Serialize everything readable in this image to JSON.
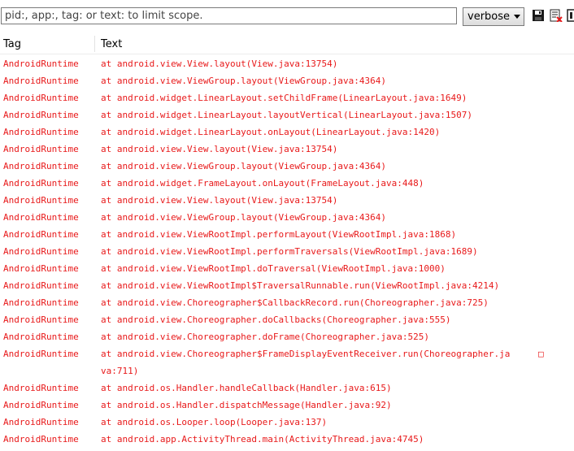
{
  "toolbar": {
    "search_placeholder": "pid:, app:, tag: or text: to limit scope.",
    "level_value": "verbose",
    "icons": [
      "save-icon",
      "clear-log-icon",
      "scroll-lock-icon"
    ]
  },
  "columns": {
    "tag": "Tag",
    "text": "Text"
  },
  "colors": {
    "error_text": "#e8191a"
  },
  "log": [
    {
      "tag": "AndroidRuntime",
      "text": "at android.view.View.layout(View.java:13754)"
    },
    {
      "tag": "AndroidRuntime",
      "text": "at android.view.ViewGroup.layout(ViewGroup.java:4364)"
    },
    {
      "tag": "AndroidRuntime",
      "text": "at android.widget.LinearLayout.setChildFrame(LinearLayout.java:1649)"
    },
    {
      "tag": "AndroidRuntime",
      "text": "at android.widget.LinearLayout.layoutVertical(LinearLayout.java:1507)"
    },
    {
      "tag": "AndroidRuntime",
      "text": "at android.widget.LinearLayout.onLayout(LinearLayout.java:1420)"
    },
    {
      "tag": "AndroidRuntime",
      "text": "at android.view.View.layout(View.java:13754)"
    },
    {
      "tag": "AndroidRuntime",
      "text": "at android.view.ViewGroup.layout(ViewGroup.java:4364)"
    },
    {
      "tag": "AndroidRuntime",
      "text": "at android.widget.FrameLayout.onLayout(FrameLayout.java:448)"
    },
    {
      "tag": "AndroidRuntime",
      "text": "at android.view.View.layout(View.java:13754)"
    },
    {
      "tag": "AndroidRuntime",
      "text": "at android.view.ViewGroup.layout(ViewGroup.java:4364)"
    },
    {
      "tag": "AndroidRuntime",
      "text": "at android.view.ViewRootImpl.performLayout(ViewRootImpl.java:1868)"
    },
    {
      "tag": "AndroidRuntime",
      "text": "at android.view.ViewRootImpl.performTraversals(ViewRootImpl.java:1689)"
    },
    {
      "tag": "AndroidRuntime",
      "text": "at android.view.ViewRootImpl.doTraversal(ViewRootImpl.java:1000)"
    },
    {
      "tag": "AndroidRuntime",
      "text": "at android.view.ViewRootImpl$TraversalRunnable.run(ViewRootImpl.java:4214)"
    },
    {
      "tag": "AndroidRuntime",
      "text": "at android.view.Choreographer$CallbackRecord.run(Choreographer.java:725)"
    },
    {
      "tag": "AndroidRuntime",
      "text": "at android.view.Choreographer.doCallbacks(Choreographer.java:555)"
    },
    {
      "tag": "AndroidRuntime",
      "text": "at android.view.Choreographer.doFrame(Choreographer.java:525)"
    },
    {
      "tag": "AndroidRuntime",
      "text": "at android.view.Choreographer$FrameDisplayEventReceiver.run(Choreographer.ja",
      "glyph": "□"
    },
    {
      "tag": "",
      "text": "va:711)"
    },
    {
      "tag": "AndroidRuntime",
      "text": "at android.os.Handler.handleCallback(Handler.java:615)"
    },
    {
      "tag": "AndroidRuntime",
      "text": "at android.os.Handler.dispatchMessage(Handler.java:92)"
    },
    {
      "tag": "AndroidRuntime",
      "text": "at android.os.Looper.loop(Looper.java:137)"
    },
    {
      "tag": "AndroidRuntime",
      "text": "at android.app.ActivityThread.main(ActivityThread.java:4745)"
    }
  ]
}
